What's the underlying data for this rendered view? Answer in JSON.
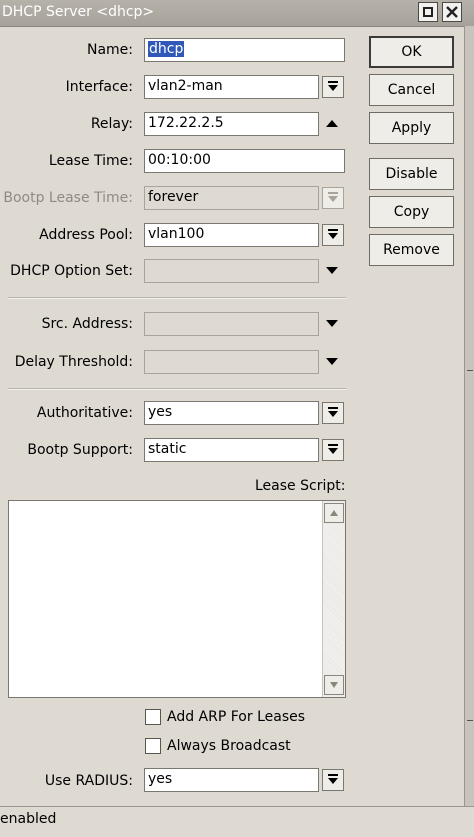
{
  "window": {
    "title": "DHCP Server <dhcp>"
  },
  "fields": {
    "name": {
      "label": "Name:",
      "value": "dhcp"
    },
    "interface": {
      "label": "Interface:",
      "value": "vlan2-man"
    },
    "relay": {
      "label": "Relay:",
      "value": "172.22.2.5"
    },
    "lease_time": {
      "label": "Lease Time:",
      "value": "00:10:00"
    },
    "bootp_lease_time": {
      "label": "Bootp Lease Time:",
      "value": "forever"
    },
    "address_pool": {
      "label": "Address Pool:",
      "value": "vlan100"
    },
    "dhcp_option_set": {
      "label": "DHCP Option Set:",
      "value": ""
    },
    "src_address": {
      "label": "Src. Address:",
      "value": ""
    },
    "delay_threshold": {
      "label": "Delay Threshold:",
      "value": ""
    },
    "authoritative": {
      "label": "Authoritative:",
      "value": "yes"
    },
    "bootp_support": {
      "label": "Bootp Support:",
      "value": "static"
    },
    "lease_script": {
      "label": "Lease Script:",
      "value": ""
    },
    "use_radius": {
      "label": "Use RADIUS:",
      "value": "yes"
    }
  },
  "checkboxes": {
    "add_arp": {
      "label": "Add ARP For Leases",
      "checked": false
    },
    "always_broadcast": {
      "label": "Always Broadcast",
      "checked": false
    }
  },
  "buttons": {
    "ok": "OK",
    "cancel": "Cancel",
    "apply": "Apply",
    "disable": "Disable",
    "copy": "Copy",
    "remove": "Remove"
  },
  "status": {
    "text": "enabled"
  }
}
